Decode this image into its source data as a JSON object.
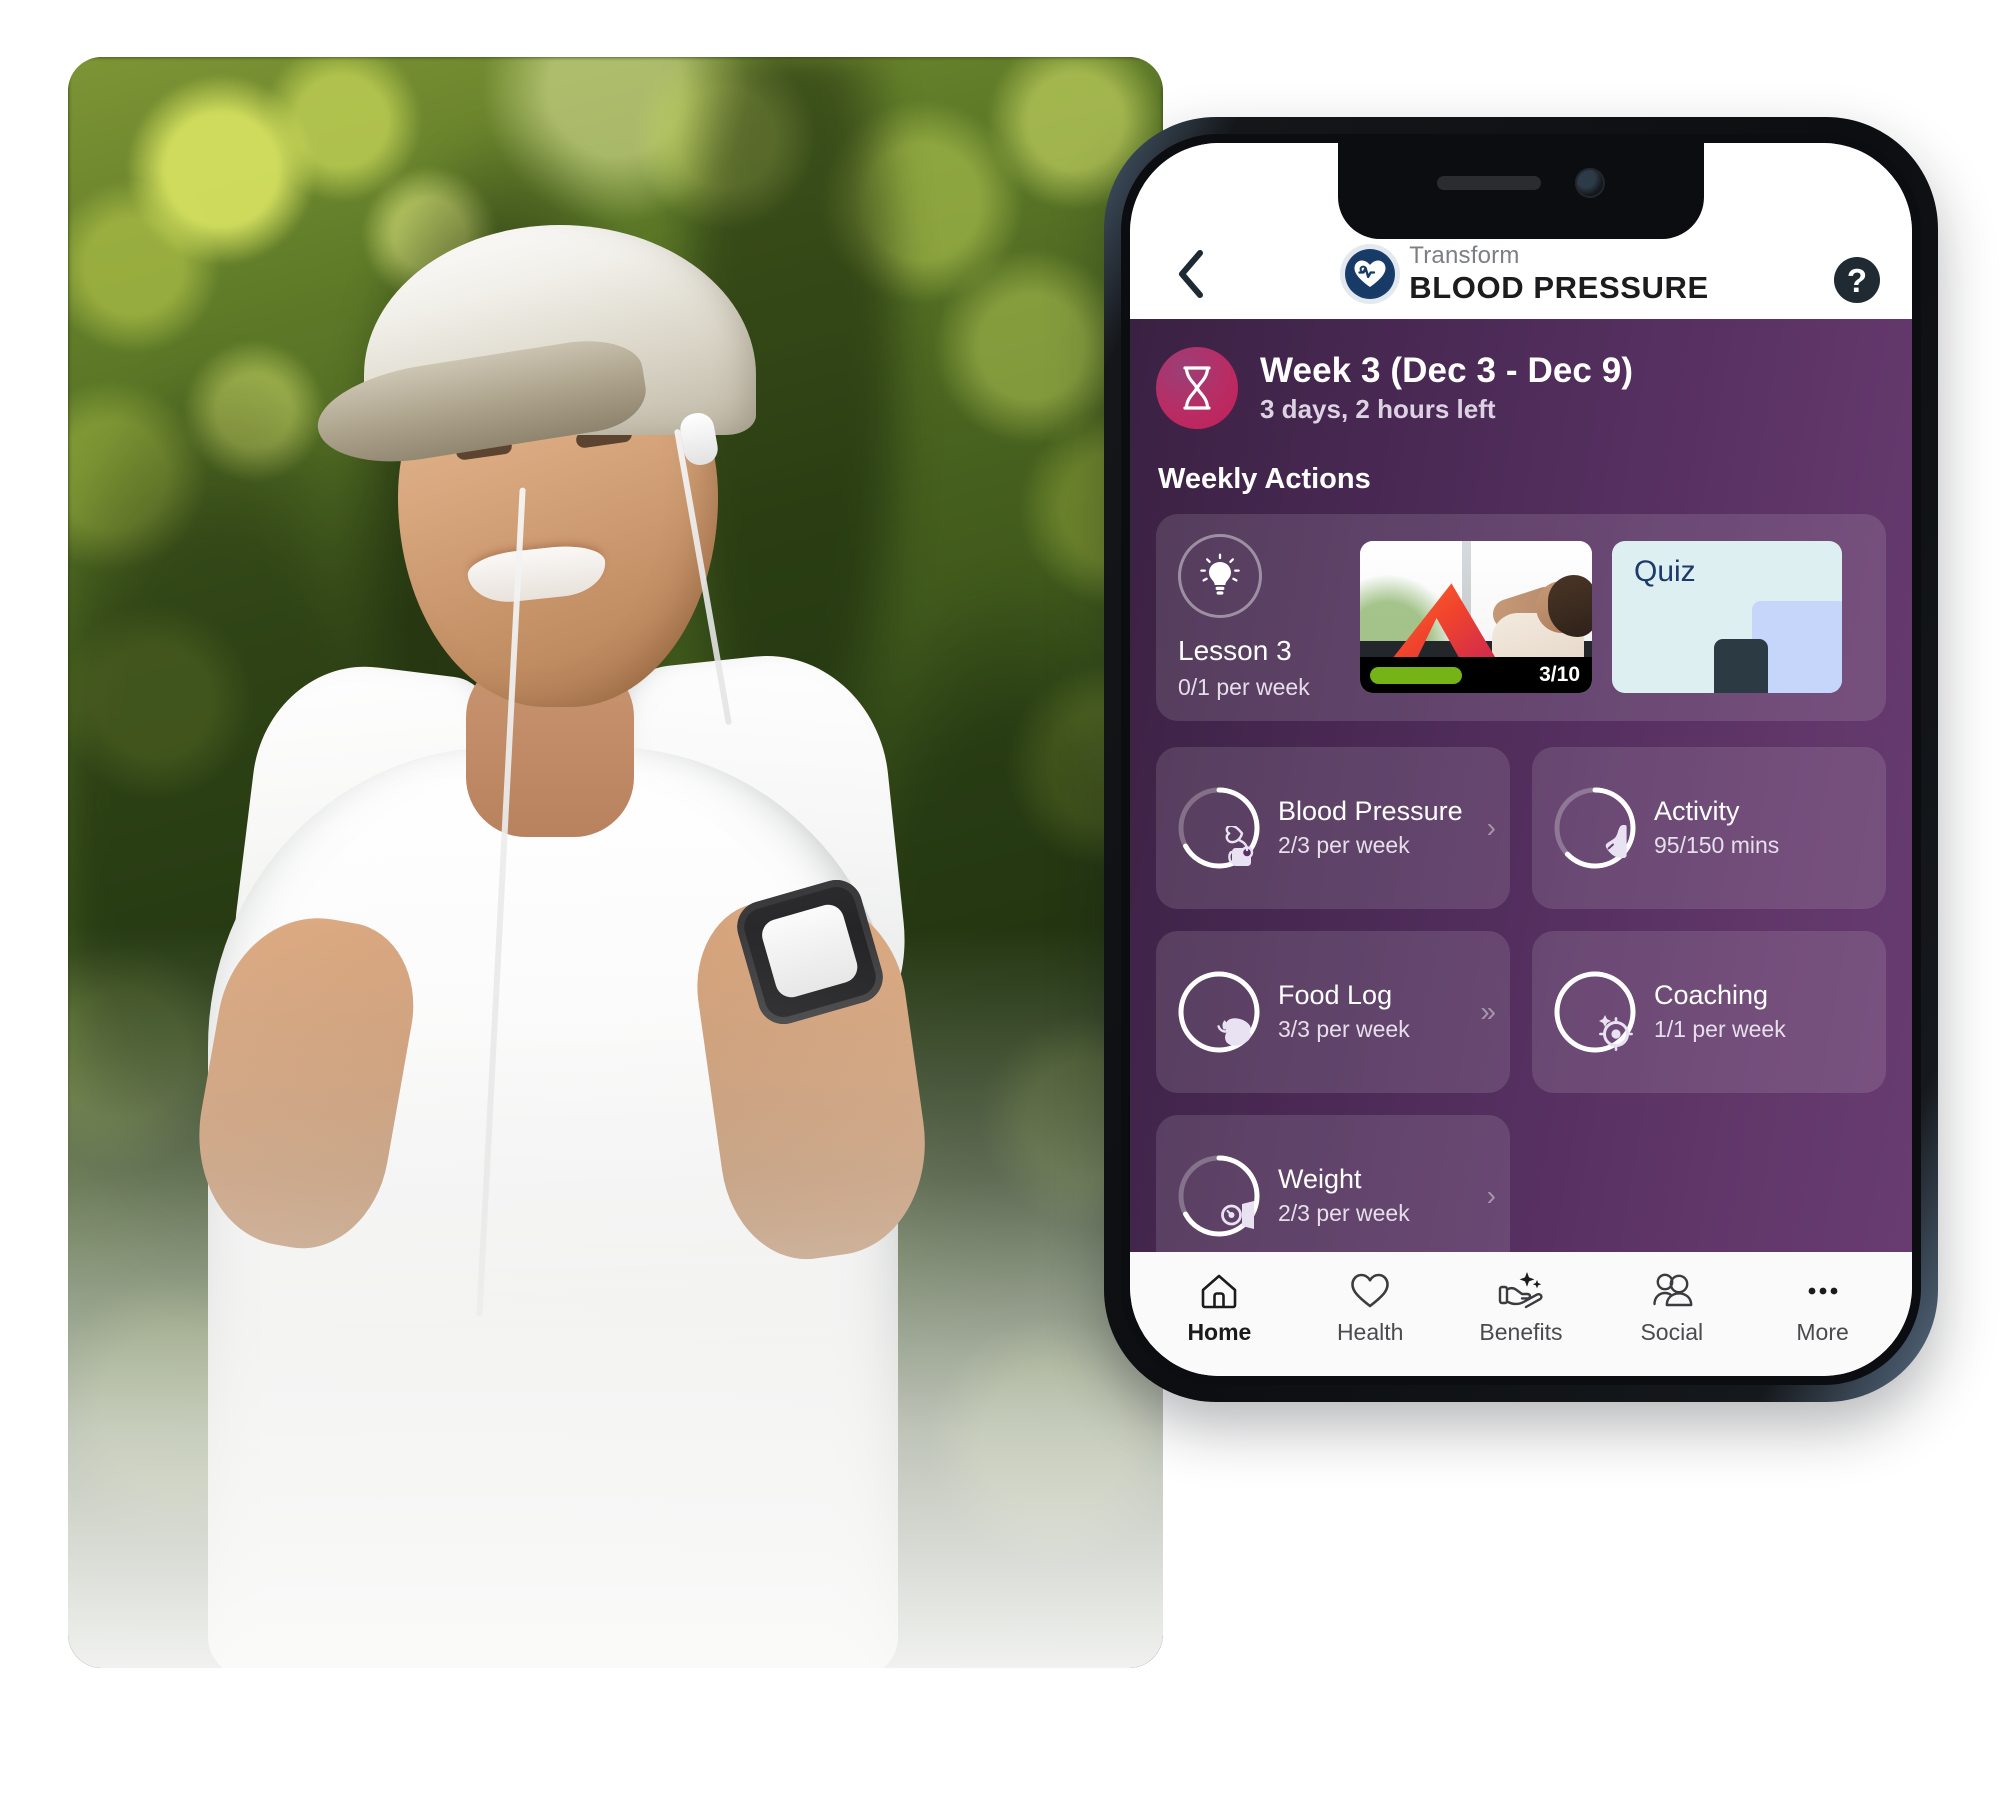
{
  "photo": {
    "alt_description": "Smiling man in white t-shirt and cap with towel around neck jogging outdoors among green trees",
    "subject_icon": "jogger-photo"
  },
  "phone": {
    "notch": {
      "speaker_icon": "speaker-grille-icon",
      "camera_icon": "front-camera-icon"
    }
  },
  "header": {
    "back_icon": "chevron-left-icon",
    "logo_icon": "heart-ecg-logo-icon",
    "brand_top": "Transform",
    "brand_bottom": "BLOOD PRESSURE",
    "help_icon": "question-mark-icon",
    "help_label": "?"
  },
  "week_banner": {
    "icon": "hourglass-icon",
    "title": "Week 3 (Dec 3 - Dec 9)",
    "subtitle": "3 days, 2 hours left",
    "badge_color": "#c41e55"
  },
  "section": {
    "title": "Weekly Actions"
  },
  "lesson": {
    "icon": "lightbulb-icon",
    "name": "Lesson 3",
    "meta": "0/1 per week",
    "video": {
      "icon": "video-thumbnail",
      "progress_count": "3/10",
      "progress_color": "#76b316",
      "progress_percent": 30
    },
    "quiz": {
      "label": "Quiz",
      "icon": "quiz-card-icon"
    }
  },
  "tiles": [
    {
      "name": "Blood Pressure",
      "meta": "2/3 per week",
      "icon": "blood-pressure-cuff-icon",
      "progress_percent": 67,
      "chevron": "›"
    },
    {
      "name": "Activity",
      "meta": "95/150 mins",
      "icon": "running-shoe-icon",
      "progress_percent": 63,
      "chevron": ""
    },
    {
      "name": "Food Log",
      "meta": "3/3 per week",
      "icon": "apple-icon",
      "progress_percent": 100,
      "chevron": "»"
    },
    {
      "name": "Coaching",
      "meta": "1/1 per week",
      "icon": "coaching-target-icon",
      "progress_percent": 100,
      "chevron": ""
    },
    {
      "name": "Weight",
      "meta": "2/3 per week",
      "icon": "weight-scale-icon",
      "progress_percent": 67,
      "chevron": "›"
    }
  ],
  "bottom_nav": [
    {
      "label": "Home",
      "icon": "home-icon",
      "active": true
    },
    {
      "label": "Health",
      "icon": "heart-icon",
      "active": false
    },
    {
      "label": "Benefits",
      "icon": "hand-sparkle-icon",
      "active": false
    },
    {
      "label": "Social",
      "icon": "people-icon",
      "active": false
    },
    {
      "label": "More",
      "icon": "ellipsis-icon",
      "active": false
    }
  ],
  "colors": {
    "purple_dark": "#3a2142",
    "purple_light": "#683c71",
    "accent_pink": "#c41e55",
    "brand_navy": "#173a66",
    "progress_green": "#76b316",
    "quiz_bg": "#ddeff1"
  }
}
